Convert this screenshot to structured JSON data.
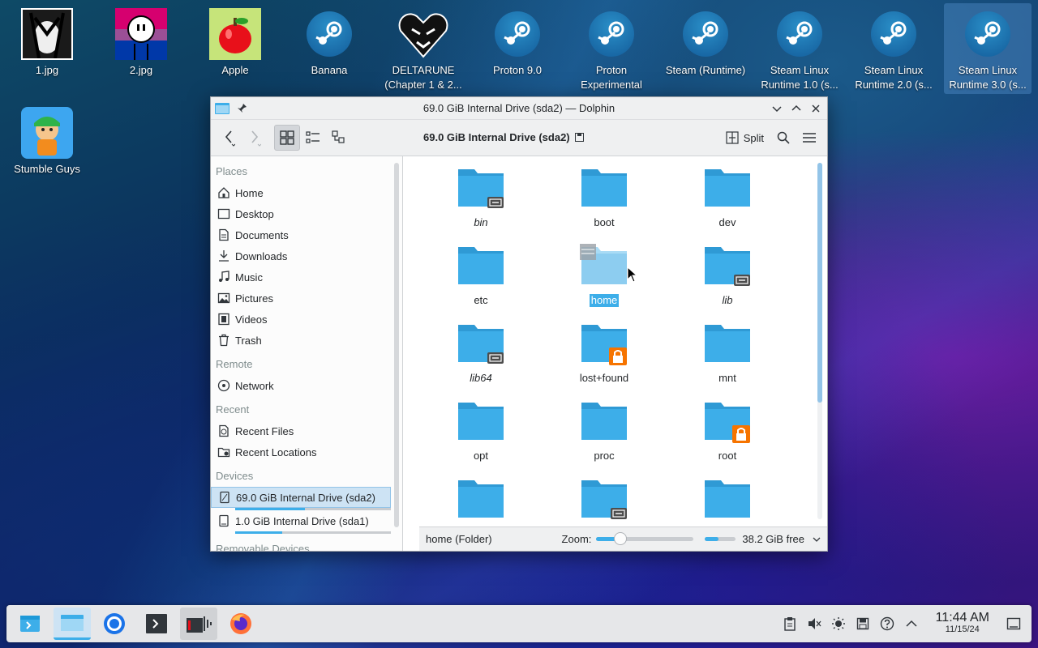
{
  "desktop": {
    "icons": [
      {
        "label": "1.jpg"
      },
      {
        "label": "2.jpg"
      },
      {
        "label": "Apple"
      },
      {
        "label": "Banana"
      },
      {
        "label": "DELTARUNE (Chapter 1 & 2..."
      },
      {
        "label": "Proton 9.0"
      },
      {
        "label": "Proton Experimental"
      },
      {
        "label": "Steam (Runtime)"
      },
      {
        "label": "Steam Linux Runtime 1.0 (s..."
      },
      {
        "label": "Steam Linux Runtime 2.0 (s..."
      },
      {
        "label": "Steam Linux Runtime 3.0 (s..."
      },
      {
        "label": "Stumble Guys"
      }
    ]
  },
  "window": {
    "title": "69.0 GiB Internal Drive (sda2) — Dolphin",
    "location": "69.0 GiB Internal Drive (sda2)",
    "split_label": "Split"
  },
  "sidebar": {
    "sections": {
      "places": "Places",
      "remote": "Remote",
      "recent": "Recent",
      "devices": "Devices",
      "removable": "Removable Devices"
    },
    "places": [
      "Home",
      "Desktop",
      "Documents",
      "Downloads",
      "Music",
      "Pictures",
      "Videos",
      "Trash"
    ],
    "remote": [
      "Network"
    ],
    "recent": [
      "Recent Files",
      "Recent Locations"
    ],
    "devices": [
      {
        "label": "69.0 GiB Internal Drive (sda2)",
        "usage": 0.45
      },
      {
        "label": "1.0 GiB Internal Drive (sda1)",
        "usage": 0.3
      }
    ]
  },
  "files": [
    {
      "name": "bin",
      "italic": true,
      "badge": "link"
    },
    {
      "name": "boot",
      "italic": false,
      "badge": ""
    },
    {
      "name": "dev",
      "italic": false,
      "badge": ""
    },
    {
      "name": "etc",
      "italic": false,
      "badge": ""
    },
    {
      "name": "home",
      "italic": false,
      "badge": "",
      "selected": true
    },
    {
      "name": "lib",
      "italic": true,
      "badge": "link"
    },
    {
      "name": "lib64",
      "italic": true,
      "badge": "link"
    },
    {
      "name": "lost+found",
      "italic": false,
      "badge": "lock"
    },
    {
      "name": "mnt",
      "italic": false,
      "badge": ""
    },
    {
      "name": "opt",
      "italic": false,
      "badge": ""
    },
    {
      "name": "proc",
      "italic": false,
      "badge": ""
    },
    {
      "name": "root",
      "italic": false,
      "badge": "lock"
    },
    {
      "name": "",
      "italic": false,
      "badge": ""
    },
    {
      "name": "",
      "italic": false,
      "badge": "link"
    },
    {
      "name": "",
      "italic": false,
      "badge": ""
    }
  ],
  "status": {
    "selection": "home (Folder)",
    "zoom_label": "Zoom:",
    "zoom_level": 0.25,
    "free_space": "38.2 GiB free",
    "used_fraction": 0.45
  },
  "taskbar": {
    "time": "11:44 AM",
    "date": "11/15/24"
  },
  "colors": {
    "accent": "#3daee9",
    "folder": "#3daee9",
    "lock_badge": "#f67400"
  }
}
